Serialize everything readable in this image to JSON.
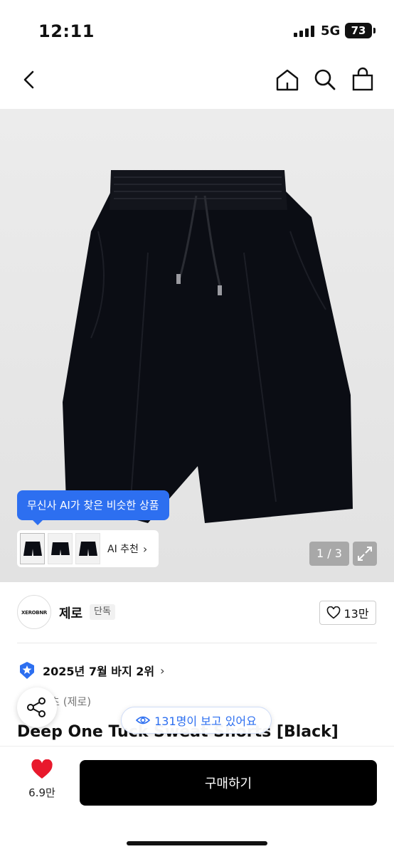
{
  "status_bar": {
    "time": "12:11",
    "network": "5G",
    "battery": "73"
  },
  "nav": {
    "icons": [
      "back-icon",
      "home-icon",
      "search-icon",
      "bag-icon"
    ]
  },
  "hero": {
    "ai_tooltip": "무신사 AI가 찾은 비슷한 상품",
    "ai_recommend_label": "AI 추천",
    "image_counter": "1 / 3"
  },
  "brand": {
    "logo_text": "XEROBNR",
    "name": "제로",
    "badge": "단독",
    "like_count": "13만"
  },
  "ranking": {
    "text": "2025년 7월 바지 2위"
  },
  "product": {
    "category": "스웻 팬츠 (제로)",
    "title": "Deep One Tuck Sweat Shorts [Black]"
  },
  "viewers": {
    "text": "131명이 보고 있어요"
  },
  "bottom_bar": {
    "wish_count": "6.9만",
    "buy_label": "구매하기"
  },
  "colors": {
    "accent": "#2d6ff0",
    "wish": "#e8192c",
    "buy_bg": "#000000"
  }
}
